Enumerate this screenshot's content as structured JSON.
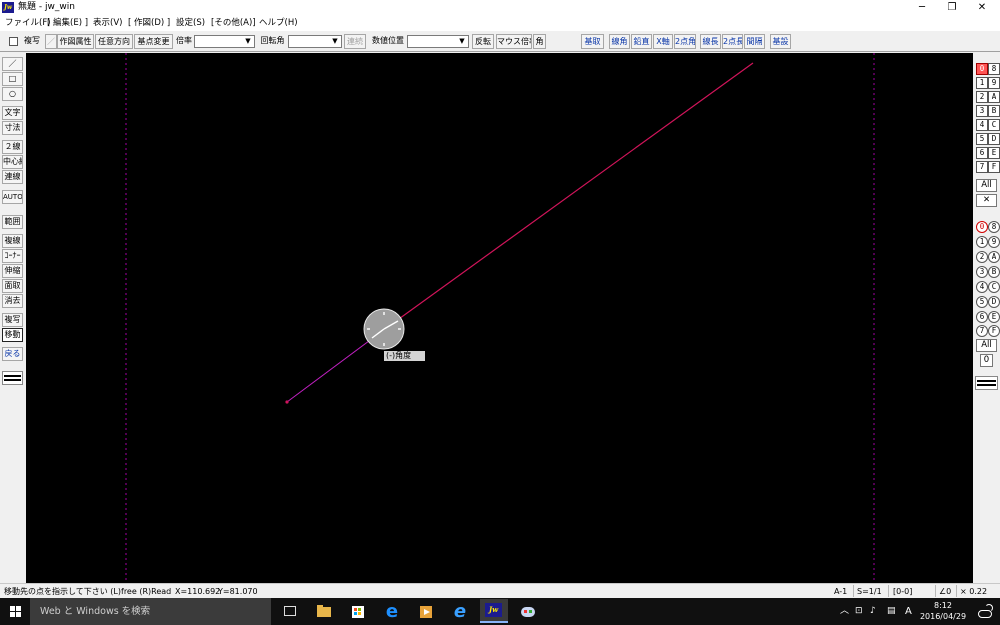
{
  "window": {
    "title": "無題 - jw_win",
    "app_icon_text": "Jw",
    "controls": {
      "minimize": "─",
      "restore": "❐",
      "close": "✕"
    }
  },
  "menu": [
    "ファイル(F)",
    "[ 編集(E) ]",
    "表示(V)",
    "[ 作図(D) ]",
    "設定(S)",
    "[その他(A)]",
    "ヘルプ(H)"
  ],
  "toolbar": {
    "fukusha_check": "複写",
    "fukusha_slash": "／",
    "sakuzu_zokusei": "作図属性",
    "nini_houkou": "任意方向",
    "kiten_henkou": "基点変更",
    "bairitsu_label": "倍率",
    "bairitsu_value": "",
    "kaitenkaku_label": "回転角",
    "kaitenkaku_value": "",
    "renzoku": "連続",
    "suuchi_ichi_label": "数値位置",
    "suuchi_ichi_value": "",
    "hanten": "反転",
    "mouse_bairitsu": "マウス倍率",
    "kaku": "角",
    "right_group": [
      "基取",
      "線角",
      "鉛直",
      "X軸",
      "2点角",
      "線長",
      "2点長",
      "間隔",
      "基設"
    ]
  },
  "left_palette": {
    "tools": [
      {
        "key": "line",
        "label": "／"
      },
      {
        "key": "rect",
        "label": "□"
      },
      {
        "key": "circle",
        "label": "○"
      },
      {
        "key": "text",
        "label": "文字"
      },
      {
        "key": "dimension",
        "label": "寸法"
      },
      {
        "key": "double-line",
        "label": "２線"
      },
      {
        "key": "center-line",
        "label": "中心線"
      },
      {
        "key": "continuous-line",
        "label": "連線"
      },
      {
        "key": "auto",
        "label": "AUTO"
      },
      {
        "key": "range",
        "label": "範囲"
      },
      {
        "key": "multi-line",
        "label": "複線"
      },
      {
        "key": "corner",
        "label": "ｺｰﾅｰ"
      },
      {
        "key": "stretch",
        "label": "伸縮"
      },
      {
        "key": "chamfer",
        "label": "面取"
      },
      {
        "key": "erase",
        "label": "消去"
      },
      {
        "key": "copy",
        "label": "複写"
      },
      {
        "key": "move",
        "label": "移動"
      },
      {
        "key": "undo",
        "label": "戻る"
      }
    ],
    "active": "move"
  },
  "canvas": {
    "angle_label": "(-)角度",
    "background": "#000000",
    "line_color": "#d1145a",
    "guide_color": "#b000b0"
  },
  "right_palette": {
    "layer_groups": [
      [
        "0",
        "8"
      ],
      [
        "1",
        "9"
      ],
      [
        "2",
        "A"
      ],
      [
        "3",
        "B"
      ],
      [
        "4",
        "C"
      ],
      [
        "5",
        "D"
      ],
      [
        "6",
        "E"
      ],
      [
        "7",
        "F"
      ]
    ],
    "group_all": "All",
    "group_x": "✕",
    "layers": [
      [
        "0",
        "8"
      ],
      [
        "1",
        "9"
      ],
      [
        "2",
        "A"
      ],
      [
        "3",
        "B"
      ],
      [
        "4",
        "C"
      ],
      [
        "5",
        "D"
      ],
      [
        "6",
        "E"
      ],
      [
        "7",
        "F"
      ]
    ],
    "layer_all": "All",
    "layer_zero": "0"
  },
  "status": {
    "message": "移動先の点を指示して下さい (L)free (R)Read",
    "x": "X=110.692",
    "y": "Y=81.070",
    "paper": "A-1",
    "scale": "S=1/1",
    "layer": "[0-0]",
    "angle": "∠0",
    "factor": "× 0.22"
  },
  "taskbar": {
    "search_placeholder": "Web と Windows を検索",
    "tray_ime": "A",
    "time": "8:12",
    "date": "2016/04/29"
  }
}
